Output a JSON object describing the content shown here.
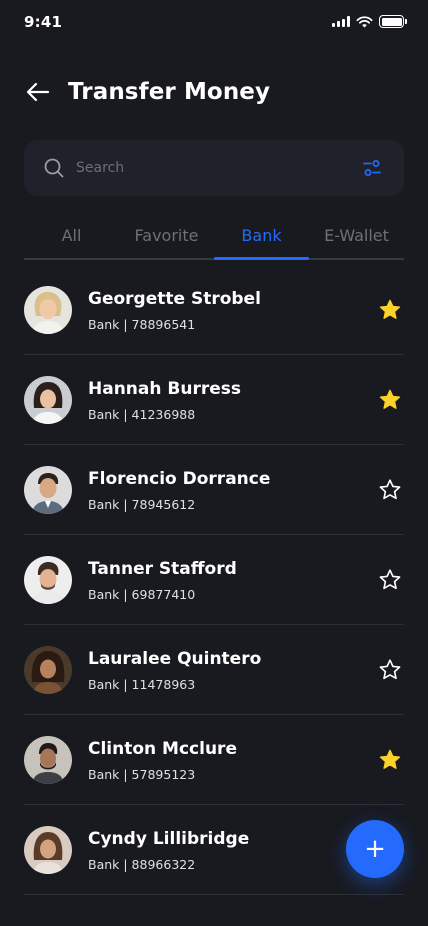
{
  "status_bar": {
    "time": "9:41"
  },
  "header": {
    "title": "Transfer Money"
  },
  "search": {
    "placeholder": "Search"
  },
  "tabs": [
    {
      "label": "All",
      "active": false
    },
    {
      "label": "Favorite",
      "active": false
    },
    {
      "label": "Bank",
      "active": true
    },
    {
      "label": "E-Wallet",
      "active": false
    }
  ],
  "contacts": [
    {
      "name": "Georgette Strobel",
      "detail": "Bank | 78896541",
      "favorite": true
    },
    {
      "name": "Hannah Burress",
      "detail": "Bank | 41236988",
      "favorite": true
    },
    {
      "name": "Florencio Dorrance",
      "detail": "Bank | 78945612",
      "favorite": false
    },
    {
      "name": "Tanner Stafford",
      "detail": "Bank | 69877410",
      "favorite": false
    },
    {
      "name": "Lauralee Quintero",
      "detail": "Bank | 11478963",
      "favorite": false
    },
    {
      "name": "Clinton Mcclure",
      "detail": "Bank | 57895123",
      "favorite": true
    },
    {
      "name": "Cyndy Lillibridge",
      "detail": "Bank | 88966322",
      "favorite": false
    }
  ],
  "fab": {
    "symbol": "+"
  },
  "colors": {
    "accent": "#246bfd",
    "background": "#181a20",
    "star": "#fbd12b"
  }
}
